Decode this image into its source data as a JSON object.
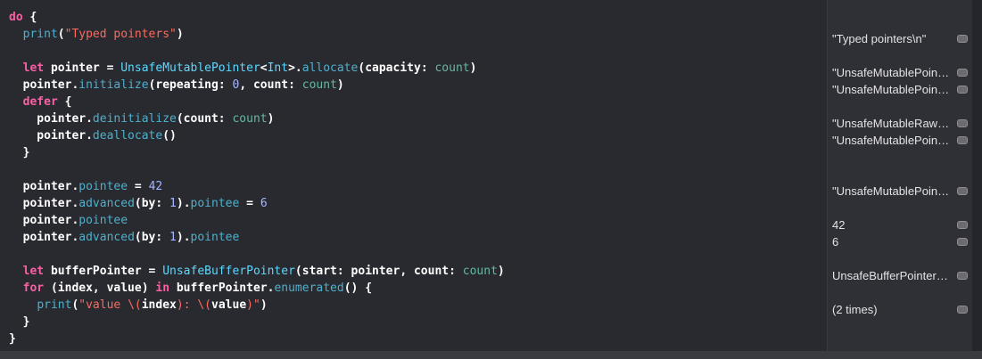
{
  "colors": {
    "editor_bg": "#292a30",
    "results_bg": "#2f3036",
    "keyword": "#fc5fa3",
    "string": "#fc6a5d",
    "type": "#5dd8ff",
    "method": "#4eb0cc",
    "number": "#d0bf69",
    "local_var": "#67b7a4"
  },
  "code": {
    "lines": [
      [
        {
          "t": "do",
          "c": "kw"
        },
        {
          "t": " {",
          "c": "plain"
        }
      ],
      [
        {
          "t": "  ",
          "c": "plain"
        },
        {
          "t": "print",
          "c": "mth"
        },
        {
          "t": "(",
          "c": "plain"
        },
        {
          "t": "\"Typed pointers\"",
          "c": "str"
        },
        {
          "t": ")",
          "c": "plain"
        }
      ],
      [],
      [
        {
          "t": "  ",
          "c": "plain"
        },
        {
          "t": "let",
          "c": "kw"
        },
        {
          "t": " pointer = ",
          "c": "plain"
        },
        {
          "t": "UnsafeMutablePointer",
          "c": "type"
        },
        {
          "t": "<",
          "c": "plain"
        },
        {
          "t": "Int",
          "c": "type"
        },
        {
          "t": ">.",
          "c": "plain"
        },
        {
          "t": "allocate",
          "c": "mth"
        },
        {
          "t": "(capacity: ",
          "c": "plain"
        },
        {
          "t": "count",
          "c": "cnt"
        },
        {
          "t": ")",
          "c": "plain"
        }
      ],
      [
        {
          "t": "  pointer.",
          "c": "plain"
        },
        {
          "t": "initialize",
          "c": "mth"
        },
        {
          "t": "(repeating: ",
          "c": "plain"
        },
        {
          "t": "0",
          "c": "lbl"
        },
        {
          "t": ", count: ",
          "c": "plain"
        },
        {
          "t": "count",
          "c": "cnt"
        },
        {
          "t": ")",
          "c": "plain"
        }
      ],
      [
        {
          "t": "  ",
          "c": "plain"
        },
        {
          "t": "defer",
          "c": "kw"
        },
        {
          "t": " {",
          "c": "plain"
        }
      ],
      [
        {
          "t": "    pointer.",
          "c": "plain"
        },
        {
          "t": "deinitialize",
          "c": "mth"
        },
        {
          "t": "(count: ",
          "c": "plain"
        },
        {
          "t": "count",
          "c": "cnt"
        },
        {
          "t": ")",
          "c": "plain"
        }
      ],
      [
        {
          "t": "    pointer.",
          "c": "plain"
        },
        {
          "t": "deallocate",
          "c": "mth"
        },
        {
          "t": "()",
          "c": "plain"
        }
      ],
      [
        {
          "t": "  }",
          "c": "plain"
        }
      ],
      [],
      [
        {
          "t": "  pointer.",
          "c": "plain"
        },
        {
          "t": "pointee",
          "c": "prop"
        },
        {
          "t": " = ",
          "c": "plain"
        },
        {
          "t": "42",
          "c": "lbl"
        }
      ],
      [
        {
          "t": "  pointer.",
          "c": "plain"
        },
        {
          "t": "advanced",
          "c": "mth"
        },
        {
          "t": "(by: ",
          "c": "plain"
        },
        {
          "t": "1",
          "c": "lbl"
        },
        {
          "t": ").",
          "c": "plain"
        },
        {
          "t": "pointee",
          "c": "prop"
        },
        {
          "t": " = ",
          "c": "plain"
        },
        {
          "t": "6",
          "c": "lbl"
        }
      ],
      [
        {
          "t": "  pointer.",
          "c": "plain"
        },
        {
          "t": "pointee",
          "c": "prop"
        }
      ],
      [
        {
          "t": "  pointer.",
          "c": "plain"
        },
        {
          "t": "advanced",
          "c": "mth"
        },
        {
          "t": "(by: ",
          "c": "plain"
        },
        {
          "t": "1",
          "c": "lbl"
        },
        {
          "t": ").",
          "c": "plain"
        },
        {
          "t": "pointee",
          "c": "prop"
        }
      ],
      [],
      [
        {
          "t": "  ",
          "c": "plain"
        },
        {
          "t": "let",
          "c": "kw"
        },
        {
          "t": " bufferPointer = ",
          "c": "plain"
        },
        {
          "t": "UnsafeBufferPointer",
          "c": "type"
        },
        {
          "t": "(start: pointer, count: ",
          "c": "plain"
        },
        {
          "t": "count",
          "c": "cnt"
        },
        {
          "t": ")",
          "c": "plain"
        }
      ],
      [
        {
          "t": "  ",
          "c": "plain"
        },
        {
          "t": "for",
          "c": "kw"
        },
        {
          "t": " (index, value) ",
          "c": "plain"
        },
        {
          "t": "in",
          "c": "kw"
        },
        {
          "t": " bufferPointer.",
          "c": "plain"
        },
        {
          "t": "enumerated",
          "c": "mth"
        },
        {
          "t": "() {",
          "c": "plain"
        }
      ],
      [
        {
          "t": "    ",
          "c": "plain"
        },
        {
          "t": "print",
          "c": "mth"
        },
        {
          "t": "(",
          "c": "plain"
        },
        {
          "t": "\"value \\(",
          "c": "str"
        },
        {
          "t": "index",
          "c": "plain"
        },
        {
          "t": "): \\(",
          "c": "str"
        },
        {
          "t": "value",
          "c": "plain"
        },
        {
          "t": ")\"",
          "c": "str"
        },
        {
          "t": ")",
          "c": "plain"
        }
      ],
      [
        {
          "t": "  }",
          "c": "plain"
        }
      ],
      [
        {
          "t": "}",
          "c": "plain"
        }
      ]
    ]
  },
  "results": [
    {
      "line": 1,
      "text": "\"Typed pointers\\n\""
    },
    {
      "line": 3,
      "text": "\"UnsafeMutablePointer<Int>\""
    },
    {
      "line": 4,
      "text": "\"UnsafeMutablePointer<Int>\""
    },
    {
      "line": 6,
      "text": "\"UnsafeMutableRawPointer\""
    },
    {
      "line": 7,
      "text": "\"UnsafeMutablePointer<Int>\""
    },
    {
      "line": 10,
      "text": "\"UnsafeMutablePointer<Int>\""
    },
    {
      "line": 12,
      "text": "42"
    },
    {
      "line": 13,
      "text": "6"
    },
    {
      "line": 15,
      "text": "UnsafeBufferPointer(start: pointer, count: count)"
    },
    {
      "line": 17,
      "text": "(2 times)"
    }
  ]
}
